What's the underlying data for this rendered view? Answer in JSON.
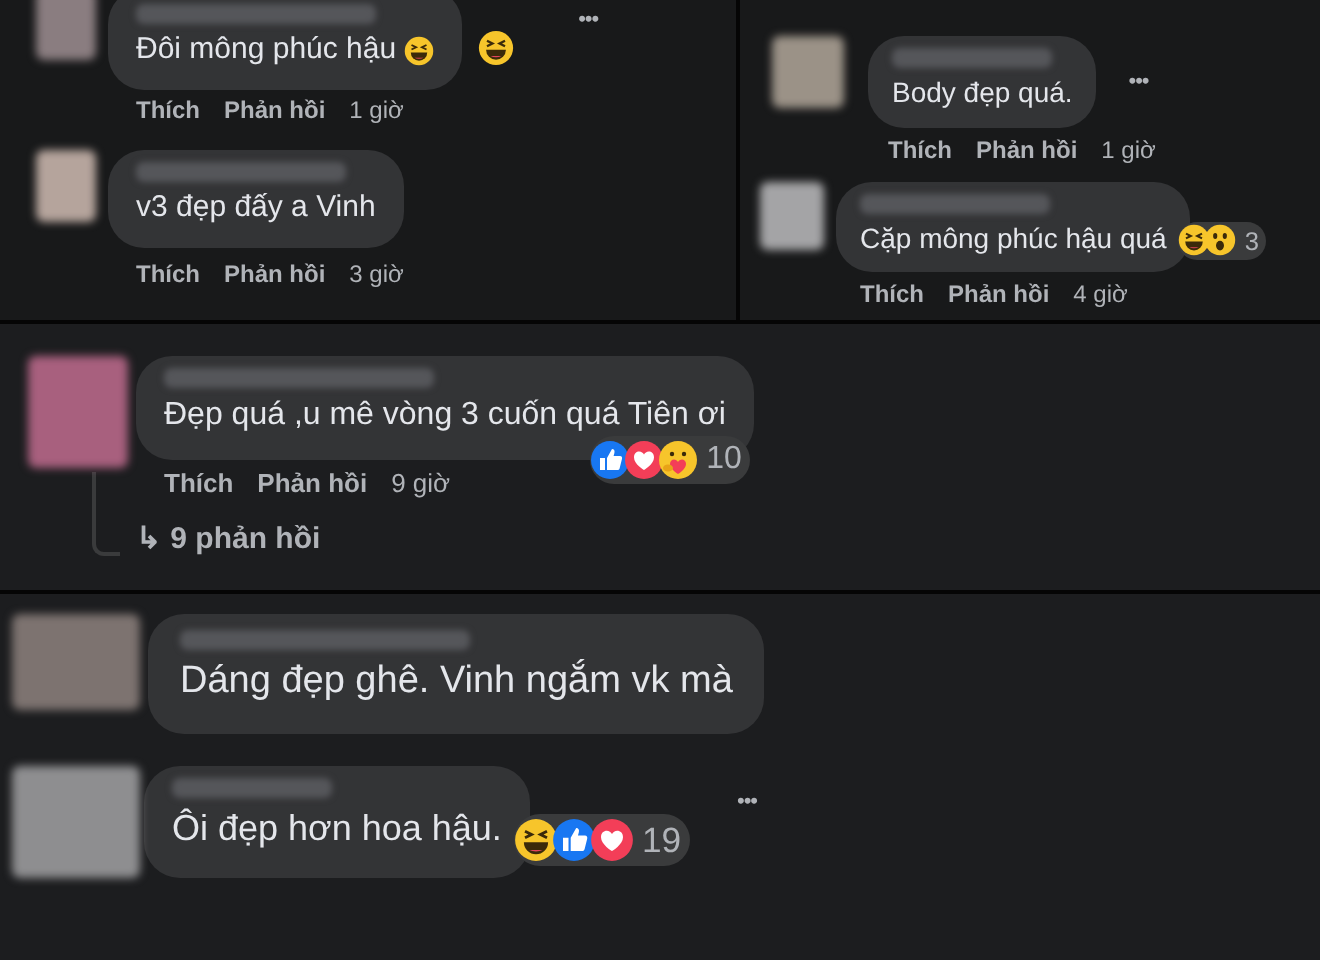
{
  "panels": [
    {
      "comments": [
        {
          "text": "Đôi mông phúc hậu",
          "inline_emojis": [
            {
              "kind": "haha"
            }
          ],
          "reactions": [
            {
              "kind": "haha"
            }
          ],
          "more": "•••",
          "actions": {
            "like": "Thích",
            "reply": "Phản hồi",
            "time": "1 giờ"
          }
        },
        {
          "text": "v3 đẹp đấy a Vinh",
          "actions": {
            "like": "Thích",
            "reply": "Phản hồi",
            "time": "3 giờ"
          }
        }
      ]
    },
    {
      "comments": [
        {
          "text": "Body đẹp quá.",
          "more": "•••",
          "actions": {
            "like": "Thích",
            "reply": "Phản hồi",
            "time": "1 giờ"
          }
        },
        {
          "text": "Cặp mông phúc hậu quá",
          "reactions": [
            {
              "kind": "haha"
            },
            {
              "kind": "wow"
            }
          ],
          "reaction_count": "3",
          "actions": {
            "like": "Thích",
            "reply": "Phản hồi",
            "time": "4 giờ"
          }
        }
      ]
    },
    {
      "comments": [
        {
          "text": "Đẹp quá ,u mê vòng 3 cuốn quá Tiên ơi",
          "reactions": [
            {
              "kind": "like"
            },
            {
              "kind": "love"
            },
            {
              "kind": "care"
            }
          ],
          "reaction_count": "10",
          "actions": {
            "like": "Thích",
            "reply": "Phản hồi",
            "time": "9 giờ"
          },
          "replies_link": "↳ 9 phản hồi"
        }
      ]
    },
    {
      "comments": [
        {
          "text": "Dáng đẹp ghê. Vinh ngắm vk mà"
        },
        {
          "text": "Ôi đẹp hơn hoa hậu.",
          "reactions": [
            {
              "kind": "haha"
            },
            {
              "kind": "like"
            },
            {
              "kind": "love"
            }
          ],
          "reaction_count": "19",
          "more": "•••"
        }
      ]
    }
  ]
}
